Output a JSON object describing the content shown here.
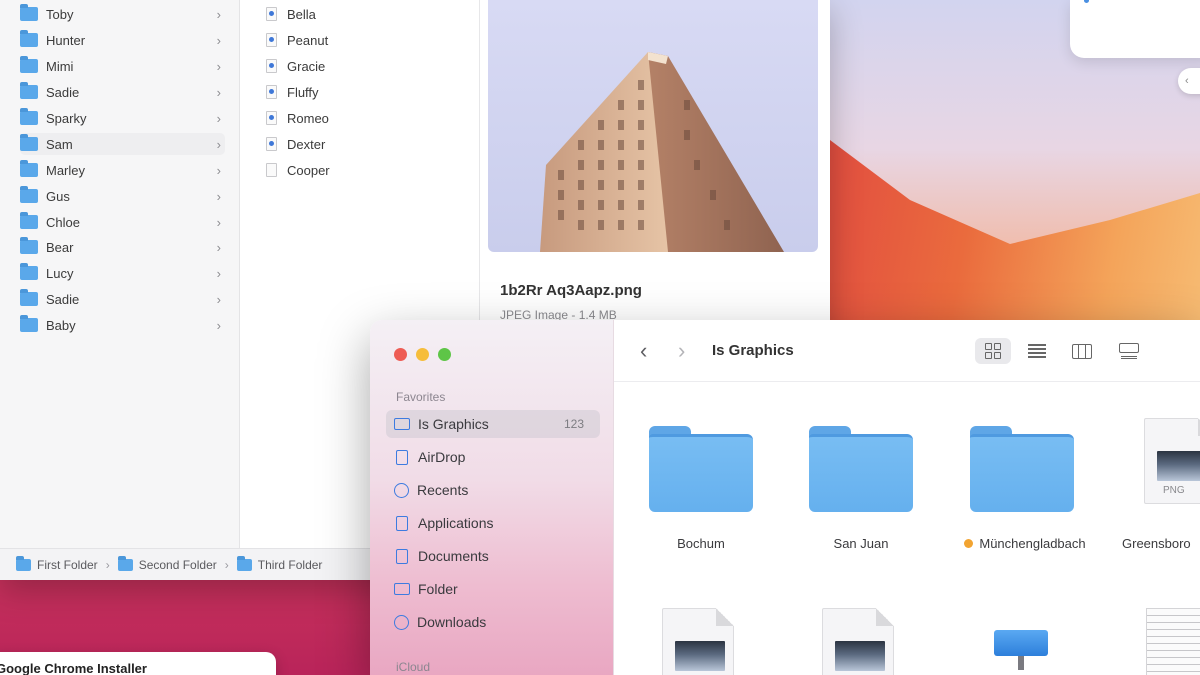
{
  "back_window": {
    "folders": [
      "Toby",
      "Hunter",
      "Mimi",
      "Sadie",
      "Sparky",
      "Sam",
      "Marley",
      "Gus",
      "Chloe",
      "Bear",
      "Lucy",
      "Sadie",
      "Baby"
    ],
    "selected_folder_index": 5,
    "files": [
      "Bella",
      "Peanut",
      "Gracie",
      "Fluffy",
      "Romeo",
      "Dexter",
      "Cooper"
    ],
    "preview": {
      "filename": "1b2Rr Aq3Aapz.png",
      "meta": "JPEG Image - 1.4 MB"
    },
    "pathbar": [
      "First Folder",
      "Second Folder",
      "Third Folder"
    ]
  },
  "installer": {
    "title": "Google Chrome Installer"
  },
  "front_window": {
    "title": "Is Graphics",
    "favorites_header": "Favorites",
    "icloud_header": "iCloud",
    "sidebar": [
      {
        "label": "Is Graphics",
        "icon": "folder-icon",
        "badge": "123",
        "active": true
      },
      {
        "label": "AirDrop",
        "icon": "airdrop-icon"
      },
      {
        "label": "Recents",
        "icon": "clock-icon"
      },
      {
        "label": "Applications",
        "icon": "applications-icon"
      },
      {
        "label": "Documents",
        "icon": "document-icon"
      },
      {
        "label": "Folder",
        "icon": "folder-icon"
      },
      {
        "label": "Downloads",
        "icon": "download-icon"
      }
    ],
    "items": [
      {
        "label": "Bochum",
        "kind": "folder"
      },
      {
        "label": "San Juan",
        "kind": "folder"
      },
      {
        "label": "Münchengladbach",
        "kind": "folder",
        "tag_color": "#f2a431"
      },
      {
        "label": "Greensboro",
        "kind": "png"
      }
    ],
    "png_ext": "PNG"
  },
  "colors": {
    "accent": "#3477e9",
    "folder": "#6db4f0",
    "tag_orange": "#f2a431"
  }
}
